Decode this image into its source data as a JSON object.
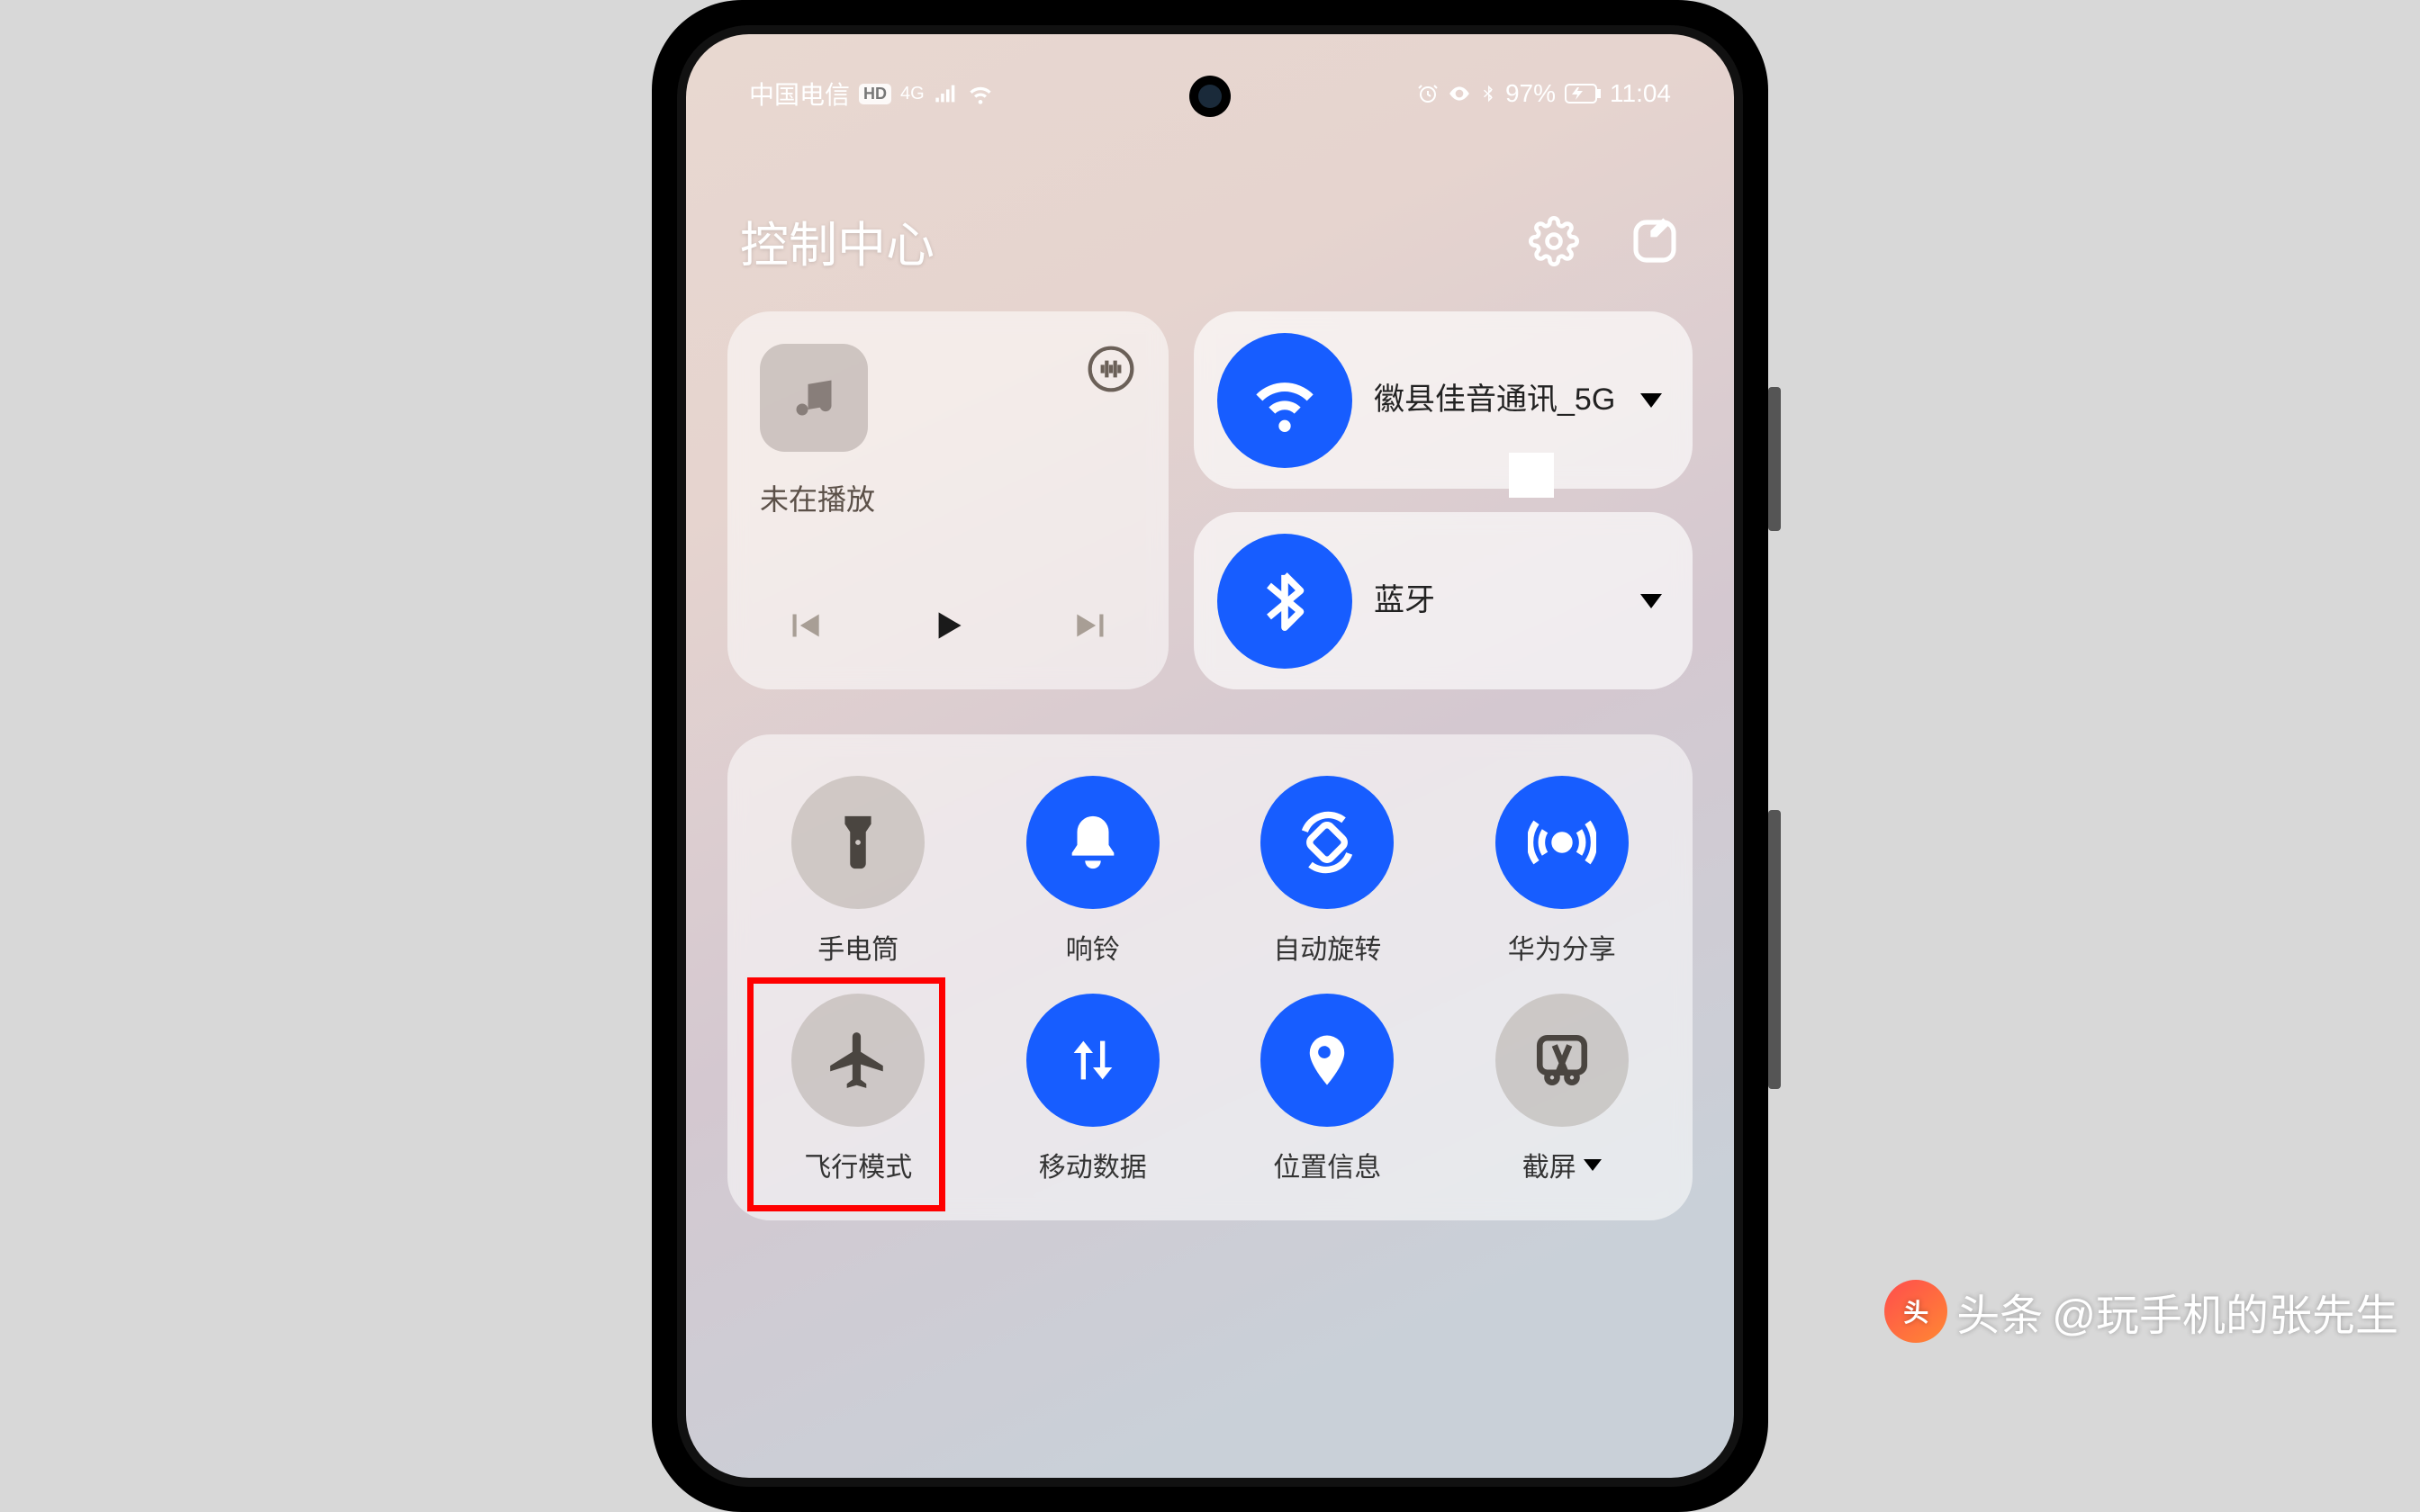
{
  "status": {
    "carrier": "中国电信",
    "hd": "HD",
    "network": "4G",
    "battery": "97%",
    "time": "11:04"
  },
  "header": {
    "title": "控制中心"
  },
  "media": {
    "status": "未在播放"
  },
  "wifi": {
    "label": "徽县佳音通讯_5G"
  },
  "bluetooth": {
    "label": "蓝牙"
  },
  "toggles": {
    "flashlight": "手电筒",
    "ringer": "响铃",
    "autorotate": "自动旋转",
    "share": "华为分享",
    "airplane": "飞行模式",
    "mobiledata": "移动数据",
    "location": "位置信息",
    "screenshot": "截屏"
  },
  "watermark": {
    "prefix": "头条",
    "handle": "@玩手机的张先生"
  }
}
